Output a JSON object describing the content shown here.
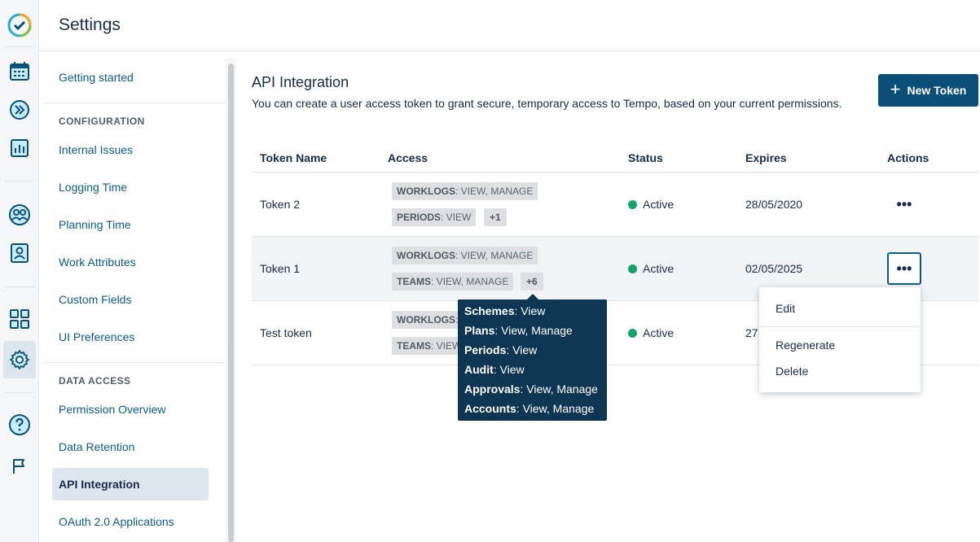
{
  "header": {
    "title": "Settings"
  },
  "nav": {
    "getting_started": "Getting started",
    "configuration_header": "CONFIGURATION",
    "internal_issues": "Internal Issues",
    "logging_time": "Logging Time",
    "planning_time": "Planning Time",
    "work_attributes": "Work Attributes",
    "custom_fields": "Custom Fields",
    "ui_preferences": "UI Preferences",
    "data_access_header": "DATA ACCESS",
    "permission_overview": "Permission Overview",
    "data_retention": "Data Retention",
    "api_integration": "API Integration",
    "oauth_apps": "OAuth 2.0 Applications"
  },
  "main": {
    "title": "API Integration",
    "description": "You can create a user access token to grant secure, temporary access to Tempo, based on your current permissions.",
    "new_token_label": "New Token"
  },
  "table": {
    "headers": {
      "name": "Token Name",
      "access": "Access",
      "status": "Status",
      "expires": "Expires",
      "actions": "Actions"
    },
    "rows": [
      {
        "name": "Token 2",
        "tag1_scope": "WORKLOGS",
        "tag1_perm": ": VIEW, MANAGE",
        "tag2_scope": "PERIODS",
        "tag2_perm": ": VIEW",
        "more": "+1",
        "status": "Active",
        "expires": "28/05/2020"
      },
      {
        "name": "Token 1",
        "tag1_scope": "WORKLOGS",
        "tag1_perm": ": VIEW, MANAGE",
        "tag2_scope": "TEAMS",
        "tag2_perm": ": VIEW, MANAGE",
        "more": "+6",
        "status": "Active",
        "expires": "02/05/2025"
      },
      {
        "name": "Test token",
        "tag1_scope": "WORKLOGS",
        "tag1_perm": ":",
        "tag2_scope": "TEAMS",
        "tag2_perm": ": VIEW",
        "status": "Active",
        "expires": "27"
      }
    ]
  },
  "tooltip": [
    {
      "scope": "Schemes",
      "perm": ": View"
    },
    {
      "scope": "Plans",
      "perm": ": View, Manage"
    },
    {
      "scope": "Periods",
      "perm": ": View"
    },
    {
      "scope": "Audit",
      "perm": ": View"
    },
    {
      "scope": "Approvals",
      "perm": ": View, Manage"
    },
    {
      "scope": "Accounts",
      "perm": ": View, Manage"
    }
  ],
  "actions_menu": {
    "edit": "Edit",
    "regenerate": "Regenerate",
    "delete": "Delete"
  },
  "icons": {
    "logo": "tempo-logo-icon",
    "calendar": "calendar-icon",
    "forward": "double-chevron-icon",
    "reports": "bar-chart-icon",
    "teams": "team-icon",
    "profile": "person-card-icon",
    "apps": "grid-icon",
    "settings": "gear-icon",
    "help": "help-icon",
    "flag": "flag-icon"
  },
  "colors": {
    "primary": "#0b4f79",
    "link": "#0b5c85",
    "active_status": "#11a36b",
    "tooltip_bg": "#0e3552"
  }
}
